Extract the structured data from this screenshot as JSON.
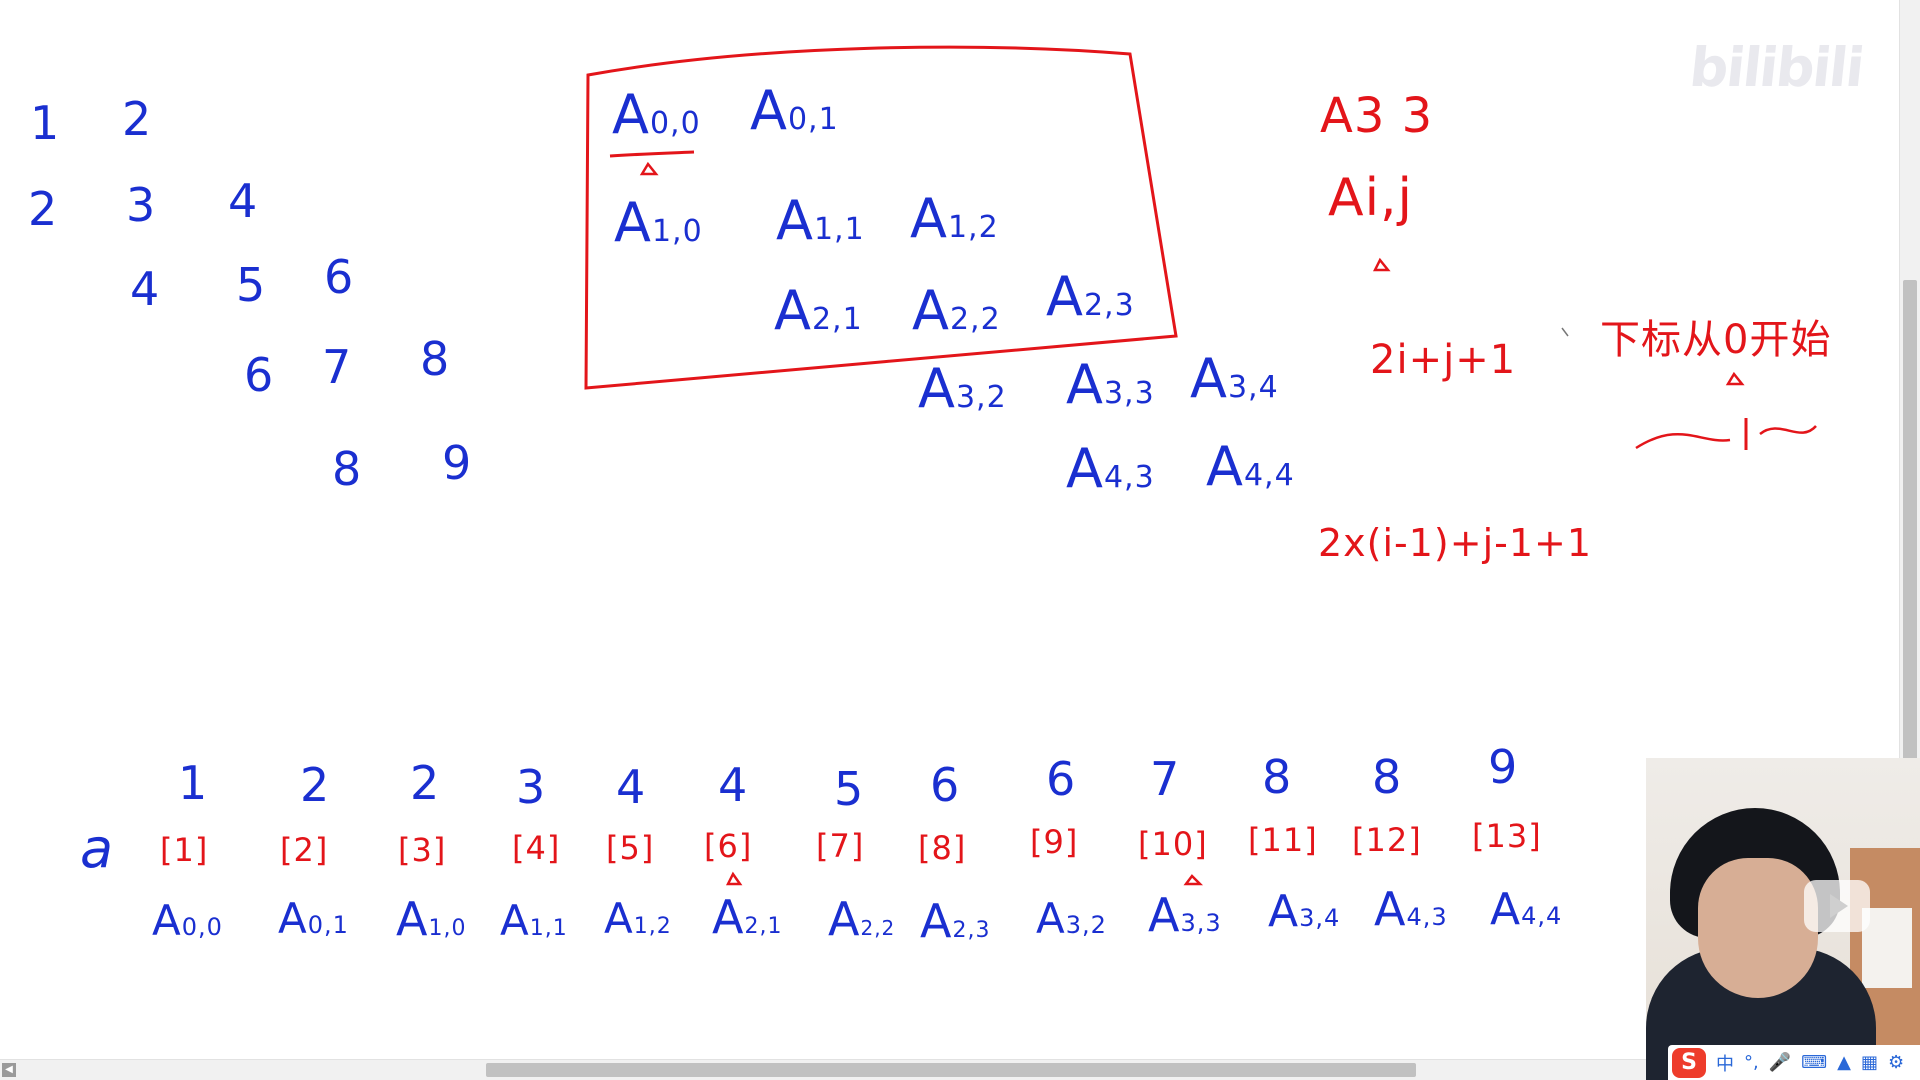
{
  "watermark": "bilibili",
  "left_numbers": {
    "row1": [
      "1",
      "2"
    ],
    "row2": [
      "2",
      "3",
      "4"
    ],
    "row3": [
      "4",
      "5",
      "6"
    ],
    "row4": [
      "6",
      "7",
      "8"
    ],
    "row5": [
      "8",
      "9"
    ]
  },
  "matrix": {
    "letter": "A",
    "r0": [
      {
        "s": "0,0"
      },
      {
        "s": "0,1"
      }
    ],
    "r1": [
      {
        "s": "1,0"
      },
      {
        "s": "1,1"
      },
      {
        "s": "1,2"
      }
    ],
    "r2": [
      {
        "s": "2,1"
      },
      {
        "s": "2,2"
      },
      {
        "s": "2,3"
      }
    ],
    "r3": [
      {
        "s": "3,2"
      },
      {
        "s": "3,3"
      },
      {
        "s": "3,4"
      }
    ],
    "r4": [
      {
        "s": "4,3"
      },
      {
        "s": "4,4"
      }
    ]
  },
  "notes": {
    "a33": "A3 3",
    "aij": "Ai,j",
    "formula1": "2i+j+1",
    "chinese": "下标从0开始",
    "dash": "—1~",
    "formula2": "2x(i-1)+j-1+1"
  },
  "array": {
    "label": "a",
    "values": [
      "1",
      "2",
      "2",
      "3",
      "4",
      "4",
      "5",
      "6",
      "6",
      "7",
      "8",
      "8",
      "9"
    ],
    "indices": [
      "[1]",
      "[2]",
      "[3]",
      "[4]",
      "[5]",
      "[6]",
      "[7]",
      "[8]",
      "[9]",
      "[10]",
      "[11]",
      "[12]",
      "[13]"
    ],
    "elements": [
      "0,0",
      "0,1",
      "1,0",
      "1,1",
      "1,2",
      "2,1",
      "2,2",
      "2,3",
      "3,2",
      "3,3",
      "3,4",
      "4,3",
      "4,4"
    ]
  },
  "ime": {
    "logo": "S",
    "lang": "中",
    "punct": "°,",
    "icons": [
      "mic-icon",
      "keyboard-icon",
      "shirt-icon",
      "grid-icon",
      "settings-icon"
    ]
  },
  "colors": {
    "blue_ink": "#1a2fd0",
    "red_ink": "#e3151a"
  }
}
